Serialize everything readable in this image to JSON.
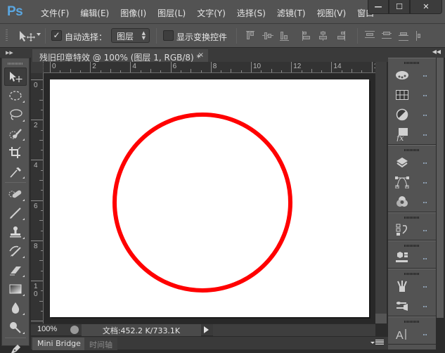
{
  "app": {
    "logo": "Ps",
    "menu": [
      "文件(F)",
      "编辑(E)",
      "图像(I)",
      "图层(L)",
      "文字(Y)",
      "选择(S)",
      "滤镜(T)",
      "视图(V)",
      "窗口"
    ],
    "window_controls": {
      "minimize": "—",
      "maximize": "☐",
      "close": "✕"
    }
  },
  "options_bar": {
    "auto_select_label": "自动选择：",
    "auto_select_checked": true,
    "auto_select_target": "图层",
    "show_transform_label": "显示变换控件",
    "show_transform_checked": false,
    "align_icons": [
      "align-top-edges-icon",
      "align-vertical-centers-icon",
      "align-bottom-edges-icon",
      "align-left-edges-icon",
      "align-horizontal-centers-icon",
      "align-right-edges-icon",
      "distribute-top-icon",
      "distribute-vertical-centers-icon",
      "distribute-bottom-icon",
      "distribute-left-icon"
    ]
  },
  "document": {
    "tab_title": "残旧印章特效 @ 100% (图层 1, RGB/8) *",
    "close_glyph": "×",
    "hruler_labels": [
      "0",
      "2",
      "4",
      "6",
      "8",
      "10",
      "12",
      "14",
      "1"
    ],
    "vruler_labels": [
      "0",
      "2",
      "4",
      "6",
      "8",
      "1\n0",
      "1"
    ],
    "shape": {
      "type": "circle",
      "stroke_color": "#ff0000",
      "fill": "none"
    }
  },
  "status": {
    "zoom": "100%",
    "doc_info": "文档:452.2 K/733.1K"
  },
  "bottom_panel": {
    "tabs": [
      "Mini Bridge",
      "时间轴"
    ],
    "active_tab": "Mini Bridge"
  },
  "toolbox": {
    "tools": [
      "move-tool",
      "elliptical-marquee-tool",
      "lasso-tool",
      "quick-selection-tool",
      "crop-tool",
      "eyedropper-tool",
      "spot-healing-brush-tool",
      "brush-tool",
      "clone-stamp-tool",
      "history-brush-tool",
      "eraser-tool",
      "gradient-tool",
      "blur-tool",
      "dodge-tool",
      "pen-tool"
    ]
  },
  "right_dock": {
    "groups": [
      [
        "color-panel-icon",
        "swatches-panel-icon",
        "adjustments-panel-icon",
        "styles-panel-icon"
      ],
      [
        "layers-panel-icon",
        "paths-panel-icon",
        "channels-panel-icon"
      ],
      [
        "history-panel-icon"
      ],
      [
        "3d-panel-icon"
      ],
      [
        "brush-presets-panel-icon",
        "brush-panel-icon"
      ],
      [
        "character-panel-icon"
      ]
    ],
    "item_label": "..."
  },
  "colors": {
    "accent_logo": "#5aa6e0",
    "circle_stroke": "#ff0000",
    "ui_panel": "#535353"
  }
}
